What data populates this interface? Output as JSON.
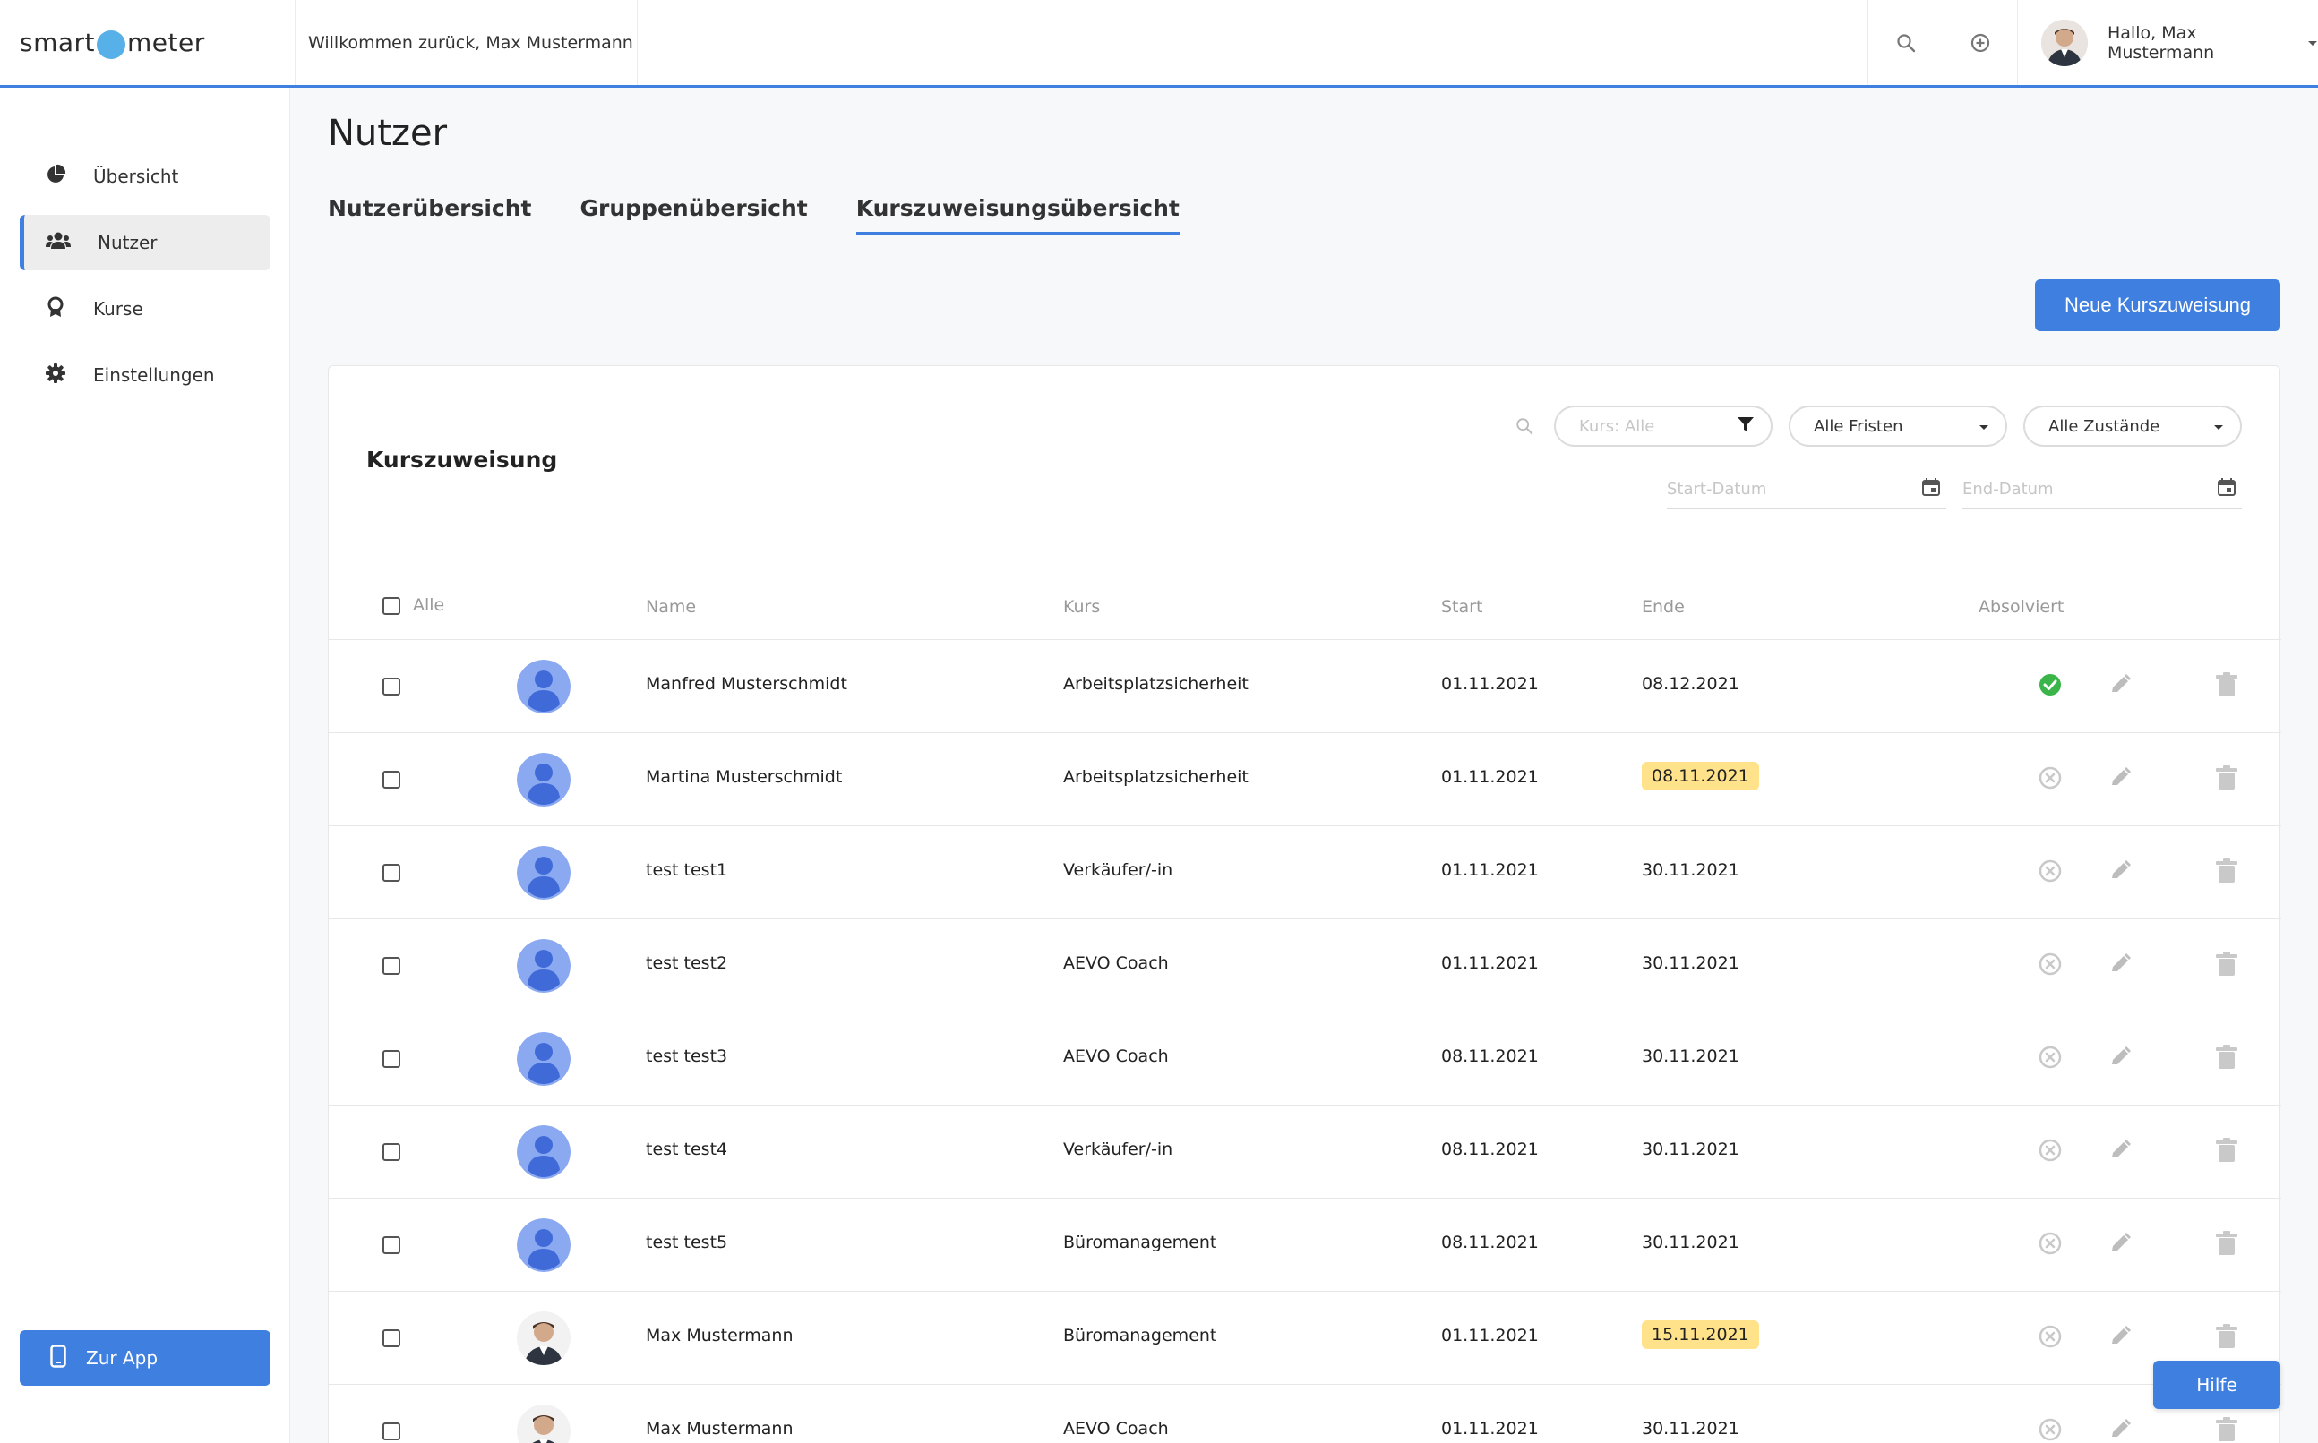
{
  "header": {
    "logo_left": "smart",
    "logo_right": "meter",
    "welcome": "Willkommen zurück, Max Mustermann",
    "user_greeting": "Hallo, Max Mustermann"
  },
  "sidebar": {
    "items": [
      {
        "label": "Übersicht",
        "icon": "pie-chart-icon"
      },
      {
        "label": "Nutzer",
        "icon": "users-icon",
        "active": true
      },
      {
        "label": "Kurse",
        "icon": "award-icon"
      },
      {
        "label": "Einstellungen",
        "icon": "gear-icon"
      }
    ],
    "zur_app": "Zur App"
  },
  "main": {
    "title": "Nutzer",
    "tabs": [
      {
        "label": "Nutzerübersicht"
      },
      {
        "label": "Gruppenübersicht"
      },
      {
        "label": "Kurszuweisungsübersicht",
        "active": true
      }
    ],
    "new_button": "Neue Kurszuweisung"
  },
  "card": {
    "title": "Kurszuweisung",
    "filters": {
      "kurs_placeholder": "Kurs: Alle",
      "fristen": "Alle Fristen",
      "zustaende": "Alle Zustände",
      "start_placeholder": "Start-Datum",
      "end_placeholder": "End-Datum"
    },
    "columns": {
      "alle": "Alle",
      "name": "Name",
      "kurs": "Kurs",
      "start": "Start",
      "ende": "Ende",
      "absolviert": "Absolviert"
    },
    "rows": [
      {
        "name": "Manfred Musterschmidt",
        "kurs": "Arbeitsplatzsicherheit",
        "start": "01.11.2021",
        "ende": "08.12.2021",
        "highlight": false,
        "done": true,
        "avatar": "placeholder"
      },
      {
        "name": "Martina Musterschmidt",
        "kurs": "Arbeitsplatzsicherheit",
        "start": "01.11.2021",
        "ende": "08.11.2021",
        "highlight": true,
        "done": false,
        "avatar": "placeholder"
      },
      {
        "name": "test test1",
        "kurs": "Verkäufer/-in",
        "start": "01.11.2021",
        "ende": "30.11.2021",
        "highlight": false,
        "done": false,
        "avatar": "placeholder"
      },
      {
        "name": "test test2",
        "kurs": "AEVO Coach",
        "start": "01.11.2021",
        "ende": "30.11.2021",
        "highlight": false,
        "done": false,
        "avatar": "placeholder"
      },
      {
        "name": "test test3",
        "kurs": "AEVO Coach",
        "start": "08.11.2021",
        "ende": "30.11.2021",
        "highlight": false,
        "done": false,
        "avatar": "placeholder"
      },
      {
        "name": "test test4",
        "kurs": "Verkäufer/-in",
        "start": "08.11.2021",
        "ende": "30.11.2021",
        "highlight": false,
        "done": false,
        "avatar": "placeholder"
      },
      {
        "name": "test test5",
        "kurs": "Büromanagement",
        "start": "08.11.2021",
        "ende": "30.11.2021",
        "highlight": false,
        "done": false,
        "avatar": "placeholder"
      },
      {
        "name": "Max Mustermann",
        "kurs": "Büromanagement",
        "start": "01.11.2021",
        "ende": "15.11.2021",
        "highlight": true,
        "done": false,
        "avatar": "photo"
      },
      {
        "name": "Max Mustermann",
        "kurs": "AEVO Coach",
        "start": "01.11.2021",
        "ende": "30.11.2021",
        "highlight": false,
        "done": false,
        "avatar": "photo"
      }
    ]
  },
  "help_button": "Hilfe",
  "colors": {
    "accent": "#3f7fe0",
    "highlight": "#ffe28a",
    "done": "#3bb54a",
    "avatar_placeholder": "#8aa9f0"
  }
}
